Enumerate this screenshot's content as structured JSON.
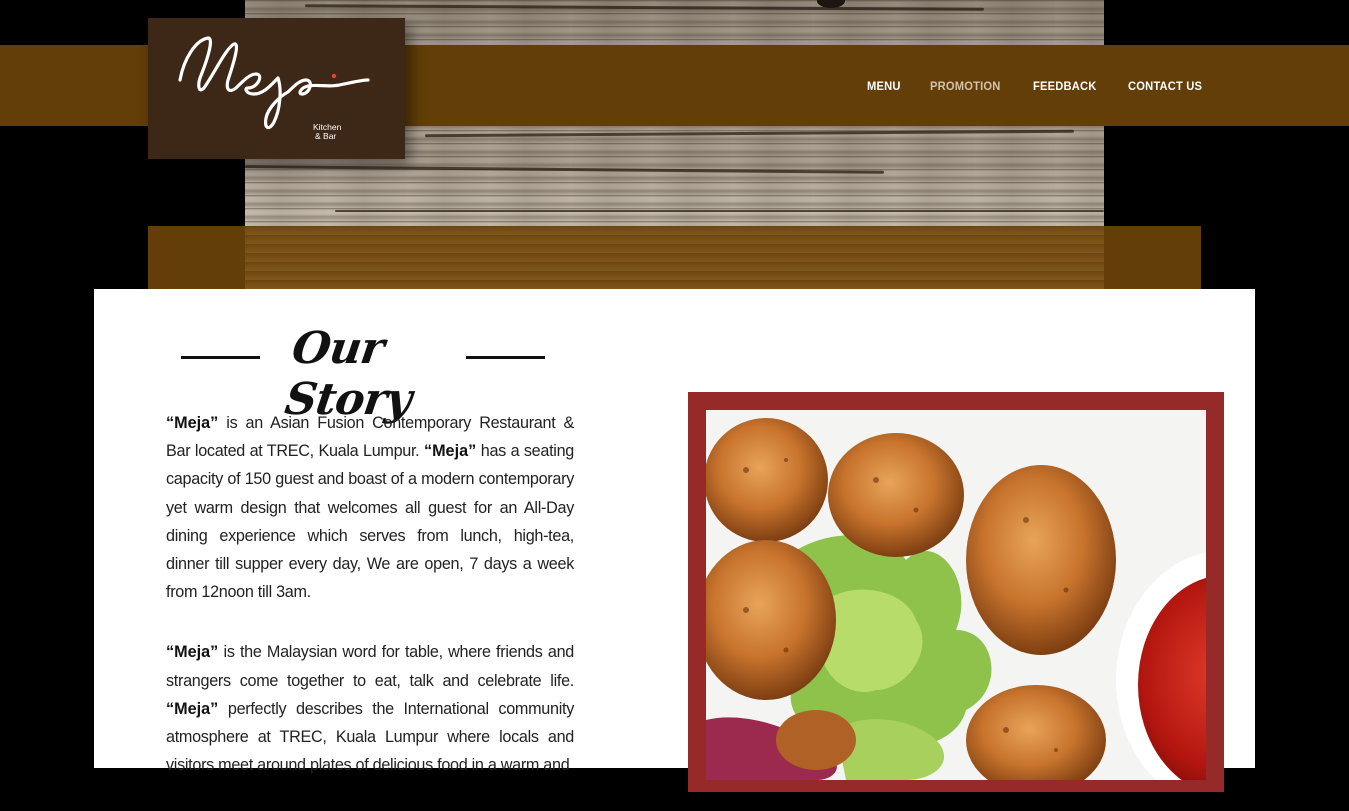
{
  "brand": {
    "logo_text": "Meja",
    "logo_subtext_line1": "Kitchen",
    "logo_subtext_line2": "& Bar"
  },
  "nav": {
    "items": [
      {
        "label": "MENU"
      },
      {
        "label": "PROMOTION"
      },
      {
        "label": "FEEDBACK"
      },
      {
        "label": "CONTACT US"
      }
    ]
  },
  "story": {
    "heading": "Our Story",
    "p1": {
      "s1": "“Meja”",
      "t1": " is an Asian Fusion Contemporary Restaurant & Bar located at TREC, Kuala Lumpur. ",
      "s2": "“Meja”",
      "t2": " has a seating capacity of 150 guest and boast of a modern contemporary yet warm design that welcomes all guest for an All-Day dining experience which serves from lunch, high-tea, dinner till supper every day, We are open, 7 days a week from 12noon till 3am."
    },
    "p2": {
      "s1": "“Meja”",
      "t1": " is the Malaysian word for table, where friends and strangers come together to eat, talk and celebrate life. ",
      "s2": "“Meja”",
      "t2": " perfectly describes the International community atmosphere at TREC, Kuala Lumpur where locals and visitors meet around plates of delicious food in a warm and"
    }
  },
  "colors": {
    "nav_band": "#633e08",
    "logo_bg": "#3d2716",
    "frame": "#962a28"
  }
}
